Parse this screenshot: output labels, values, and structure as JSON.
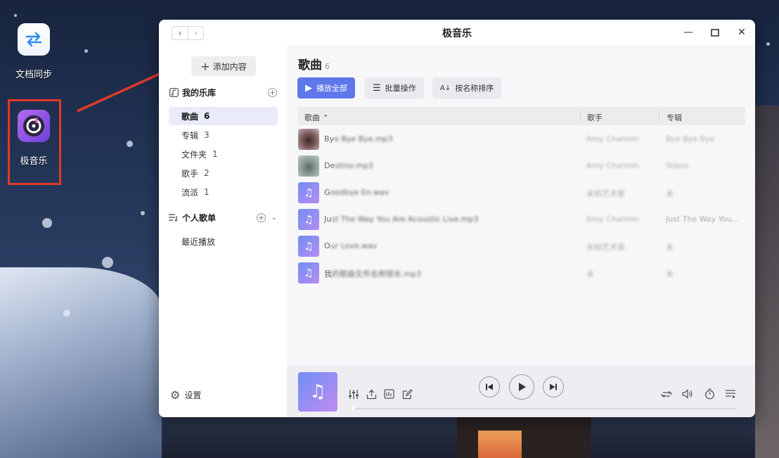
{
  "desktop": {
    "icons": [
      {
        "label": "文档同步",
        "icon": "sync-arrows-icon"
      },
      {
        "label": "极音乐",
        "icon": "music-app-icon"
      }
    ]
  },
  "window": {
    "title": "极音乐",
    "nav_back": "‹",
    "nav_forward": "›"
  },
  "sidebar": {
    "add_content_label": "添加内容",
    "library_header": "我的乐库",
    "library_items": [
      {
        "label": "歌曲",
        "count": "6",
        "active": true
      },
      {
        "label": "专辑",
        "count": "3"
      },
      {
        "label": "文件夹",
        "count": "1"
      },
      {
        "label": "歌手",
        "count": "2"
      },
      {
        "label": "流派",
        "count": "1"
      }
    ],
    "playlists_header": "个人歌单",
    "playlist_items": [
      {
        "label": "最近播放"
      }
    ],
    "settings_label": "设置"
  },
  "main": {
    "title": "歌曲",
    "count": "6",
    "toolbar": {
      "play_all": "播放全部",
      "batch": "批量操作",
      "sort": "按名称排序"
    },
    "columns": {
      "song": "歌曲 ⌃",
      "artist": "歌手",
      "album": "专辑"
    },
    "rows": [
      {
        "title_lead": "By",
        "title_rest": "e Bye Bye.mp3",
        "artist": "Amy Charmin",
        "album": "Bye Bye Bye",
        "thumb": "photo1"
      },
      {
        "title_lead": "De",
        "title_rest": "stino.mp3",
        "artist": "Amy Charmin",
        "album": "Stasis",
        "thumb": "photo2"
      },
      {
        "title_lead": "G",
        "title_rest": "oodbye En.wav",
        "artist": "未知艺术家",
        "album": "未",
        "thumb": "note"
      },
      {
        "title_lead": "Ju",
        "title_rest": "st The Way You Are Acoustic Live.mp3",
        "artist": "Amy Charmin",
        "album": "Just The Way You...",
        "thumb": "note"
      },
      {
        "title_lead": "O",
        "title_rest": "ur Love.wav",
        "artist": "未知艺术家",
        "album": "未",
        "thumb": "note"
      },
      {
        "title_lead": "我",
        "title_rest": "的歌曲文件名称很长.mp3",
        "artist": "未",
        "album": "未",
        "thumb": "note"
      }
    ]
  },
  "colors": {
    "accent": "#5e77ea",
    "highlight_red": "#e03a2a",
    "active_bg": "#e9ecf8"
  }
}
